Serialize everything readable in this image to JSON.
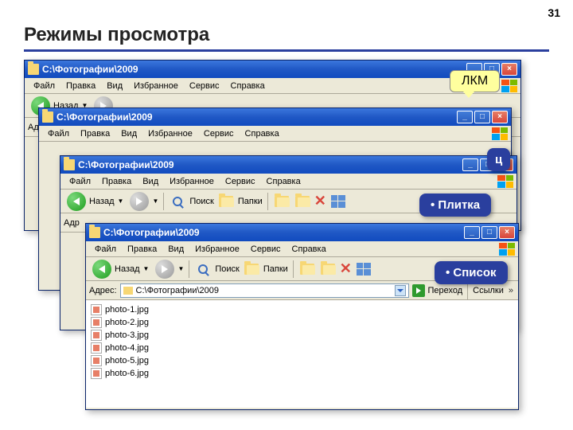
{
  "slide": {
    "number": "31",
    "title": "Режимы просмотра"
  },
  "callout": {
    "lkm": "ЛКМ"
  },
  "labels": {
    "ts": "ц",
    "tile": "• Плитка",
    "list": "• Список"
  },
  "window": {
    "title": "C:\\Фотографии\\2009",
    "menu": {
      "file": "Файл",
      "edit": "Правка",
      "view": "Вид",
      "favorites": "Избранное",
      "tools": "Сервис",
      "help": "Справка"
    },
    "toolbar": {
      "back": "Назад",
      "search": "Поиск",
      "folders": "Папки"
    },
    "address": {
      "label": "Адрес:",
      "path": "C:\\Фотографии\\2009",
      "go": "Переход",
      "links": "Ссылки"
    }
  },
  "files": [
    "photo-1.jpg",
    "photo-2.jpg",
    "photo-3.jpg",
    "photo-4.jpg",
    "photo-5.jpg",
    "photo-6.jpg"
  ],
  "addr_stub": {
    "a": "Ад",
    "b": "Адр"
  }
}
